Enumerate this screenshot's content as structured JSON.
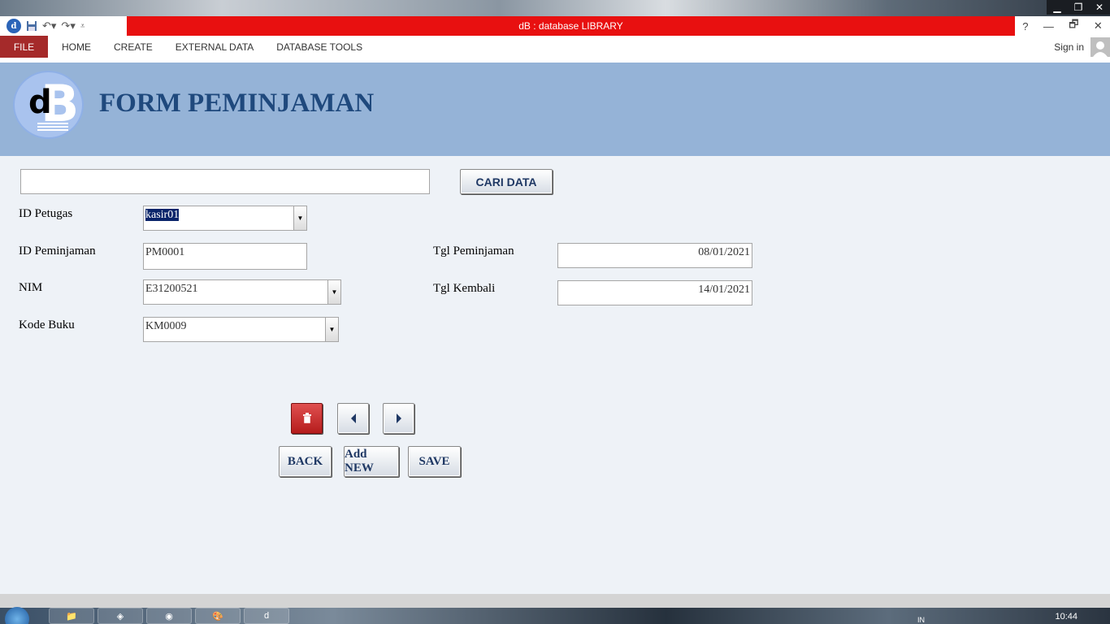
{
  "window": {
    "title": "dB : database LIBRARY",
    "help_glyph": "?",
    "minimize_glyph": "—",
    "restore_glyph": "🗗",
    "close_glyph": "✕"
  },
  "ribbon": {
    "tabs": [
      "FILE",
      "HOME",
      "CREATE",
      "EXTERNAL DATA",
      "DATABASE TOOLS"
    ],
    "sign_in": "Sign in"
  },
  "form": {
    "title": "FORM PEMINJAMAN",
    "search": {
      "value": "",
      "button": "CARI DATA"
    },
    "fields": {
      "id_petugas": {
        "label": "ID Petugas",
        "value": "kasir01"
      },
      "id_peminjaman": {
        "label": "ID Peminjaman",
        "value": "PM0001"
      },
      "nim": {
        "label": "NIM",
        "value": "E31200521"
      },
      "kode_buku": {
        "label": "Kode Buku",
        "value": "KM0009"
      },
      "tgl_peminjaman": {
        "label": "Tgl Peminjaman",
        "value": "08/01/2021"
      },
      "tgl_kembali": {
        "label": "Tgl Kembali",
        "value": "14/01/2021"
      }
    },
    "buttons": {
      "back": "BACK",
      "add_new": "Add NEW",
      "save": "SAVE"
    }
  },
  "taskbar": {
    "clock": "10:44",
    "lang": "IN"
  },
  "colors": {
    "title_bar": "#e81010",
    "file_tab": "#a52a2a",
    "header": "#95b3d7",
    "title_text": "#1f497d",
    "body": "#eef2f7"
  }
}
